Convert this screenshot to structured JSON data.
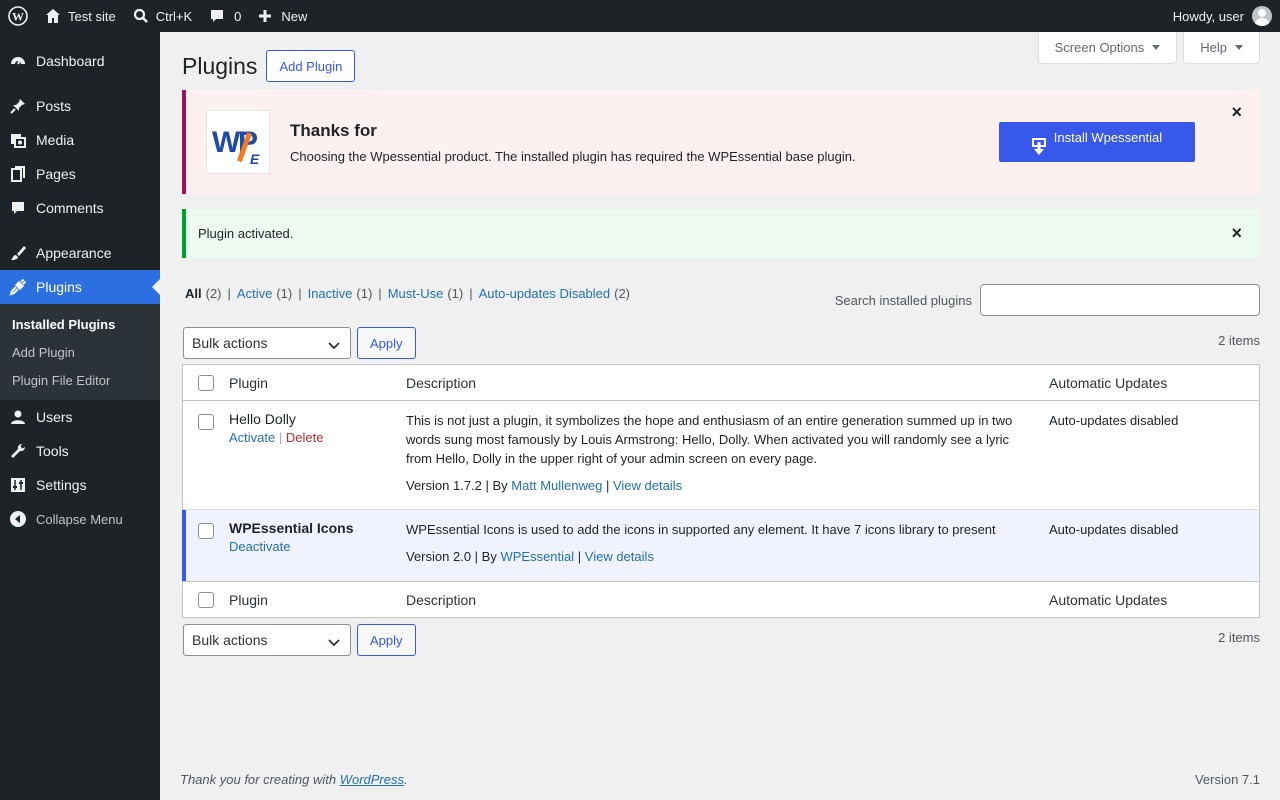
{
  "adminbar": {
    "site_name": "Test site",
    "search_shortcut": "Ctrl+K",
    "comments_count": "0",
    "new_label": "New",
    "howdy": "Howdy, user"
  },
  "sidebar": {
    "items": [
      {
        "label": "Dashboard",
        "icon": "dashboard-icon"
      },
      {
        "label": "Posts",
        "icon": "pin-icon"
      },
      {
        "label": "Media",
        "icon": "media-icon"
      },
      {
        "label": "Pages",
        "icon": "pages-icon"
      },
      {
        "label": "Comments",
        "icon": "comment-icon"
      },
      {
        "label": "Appearance",
        "icon": "brush-icon"
      },
      {
        "label": "Plugins",
        "icon": "plug-icon"
      },
      {
        "label": "Users",
        "icon": "user-icon"
      },
      {
        "label": "Tools",
        "icon": "wrench-icon"
      },
      {
        "label": "Settings",
        "icon": "sliders-icon"
      }
    ],
    "submenu": [
      "Installed Plugins",
      "Add Plugin",
      "Plugin File Editor"
    ],
    "collapse": "Collapse Menu"
  },
  "screen_meta": {
    "screen_options": "Screen Options",
    "help": "Help"
  },
  "page": {
    "title": "Plugins",
    "add_button": "Add Plugin"
  },
  "promo": {
    "heading": "Thanks for",
    "text": "Choosing the Wpessential product. The installed plugin has required the WPEssential base plugin.",
    "button": "Install Wpessential",
    "close": "×"
  },
  "notice": {
    "text": "Plugin activated.",
    "close": "×"
  },
  "filters": [
    {
      "label": "All",
      "count": "(2)"
    },
    {
      "label": "Active",
      "count": "(1)"
    },
    {
      "label": "Inactive",
      "count": "(1)"
    },
    {
      "label": "Must-Use",
      "count": "(1)"
    },
    {
      "label": "Auto-updates Disabled",
      "count": "(2)"
    }
  ],
  "search": {
    "label": "Search installed plugins",
    "value": ""
  },
  "tablenav": {
    "bulk": "Bulk actions",
    "apply": "Apply",
    "items": "2 items"
  },
  "table": {
    "headers": {
      "plugin": "Plugin",
      "description": "Description",
      "auto": "Automatic Updates"
    },
    "rows": [
      {
        "name": "Hello Dolly",
        "actions": [
          "Activate",
          "Delete"
        ],
        "description": "This is not just a plugin, it symbolizes the hope and enthusiasm of an entire generation summed up in two words sung most famously by Louis Armstrong: Hello, Dolly. When activated you will randomly see a lyric from Hello, Dolly in the upper right of your admin screen on every page.",
        "version": "Version 1.7.2",
        "by": "By",
        "author": "Matt Mullenweg",
        "details": "View details",
        "auto": "Auto-updates disabled"
      },
      {
        "name": "WPEssential Icons",
        "actions": [
          "Deactivate"
        ],
        "description": "WPEssential Icons is used to add the icons in supported any element. It have 7 icons library to present",
        "version": "Version 2.0",
        "by": "By",
        "author": "WPEssential",
        "details": "View details",
        "auto": "Auto-updates disabled"
      }
    ]
  },
  "footer": {
    "thanks_prefix": "Thank you for creating with ",
    "wp_link": "WordPress",
    "thanks_suffix": ".",
    "version": "Version 7.1"
  },
  "colors": {
    "accent": "#3858e9",
    "adminbar": "#1d2327",
    "promo_border": "#a0105c",
    "success_border": "#00a32a"
  }
}
